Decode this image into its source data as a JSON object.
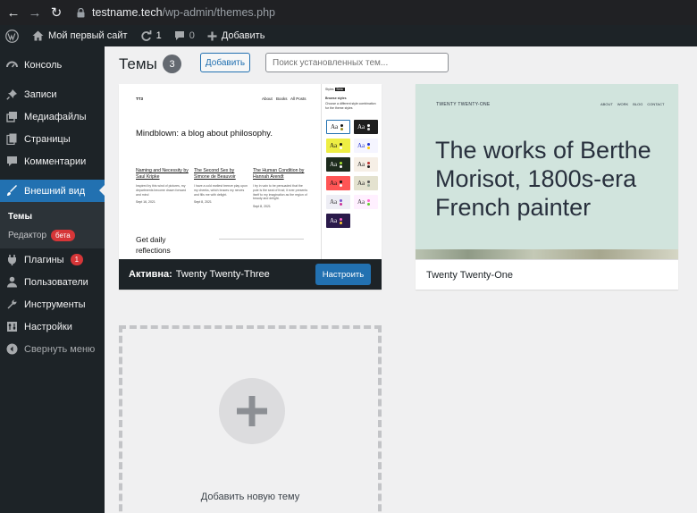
{
  "browser": {
    "back": "←",
    "forward": "→",
    "reload": "↻",
    "url_host": "testname.tech",
    "url_path": "/wp-admin/themes.php"
  },
  "adminbar": {
    "site_name": "Мой первый сайт",
    "updates_count": "1",
    "comments_count": "0",
    "add_new": "Добавить"
  },
  "sidebar": {
    "items": [
      {
        "label": "Консоль",
        "icon": "dashboard-icon"
      },
      {
        "label": "Записи",
        "icon": "pin-icon"
      },
      {
        "label": "Медиафайлы",
        "icon": "media-icon"
      },
      {
        "label": "Страницы",
        "icon": "pages-icon"
      },
      {
        "label": "Комментарии",
        "icon": "comment-icon"
      },
      {
        "label": "Внешний вид",
        "icon": "brush-icon"
      }
    ],
    "submenu": [
      {
        "label": "Темы"
      },
      {
        "label": "Редактор",
        "badge": "бета"
      }
    ],
    "items_after": [
      {
        "label": "Плагины",
        "icon": "plugin-icon",
        "badge": "1"
      },
      {
        "label": "Пользователи",
        "icon": "users-icon"
      },
      {
        "label": "Инструменты",
        "icon": "wrench-icon"
      },
      {
        "label": "Настройки",
        "icon": "settings-icon"
      }
    ],
    "collapse": "Свернуть меню"
  },
  "main": {
    "title": "Темы",
    "theme_count": "3",
    "add_button": "Добавить",
    "search_placeholder": "Поиск установленных тем..."
  },
  "themes": {
    "active": {
      "active_label": "Активна:",
      "name": "Twenty Twenty-Three",
      "customize": "Настроить",
      "preview": {
        "brand": "TT3",
        "nav": [
          "About",
          "Books",
          "All Posts"
        ],
        "headline": "Mindblown: a blog about philosophy.",
        "posts": [
          {
            "title": "Naming and Necessity by Saul Kripke",
            "excerpt": "Inspired by this wind of pictures, my departments become drawn forward and mind",
            "date": "Sept 16, 2021"
          },
          {
            "title": "The Second Sex by Simone de Beauvoir",
            "excerpt": "I have a cold earliest breeze play upon my cheeks, which braces my nerves and fills me with delight.",
            "date": "Sept 8, 2021"
          },
          {
            "title": "The Human Condition by Hannah Arendt",
            "excerpt": "I try in vain to be persuaded that the pole is the seat of frost; it ever presents itself to my imagination as the region of beauty and delight.",
            "date": "Sept 8, 2021"
          }
        ],
        "daily": "Get daily reflections",
        "styles_title": "Styles",
        "styles_tag": "Beta",
        "styles_sub": "Browse styles",
        "styles_desc": "Choose a different style combination for the theme styles",
        "swatch_text": "Aa"
      }
    },
    "second": {
      "name": "Twenty Twenty-One",
      "preview": {
        "brand": "TWENTY TWENTY-ONE",
        "nav": [
          "ABOUT",
          "WORK",
          "BLOG",
          "CONTACT"
        ],
        "headline": "The works of Berthe Morisot, 1800s-era French painter"
      }
    },
    "add_new_label": "Добавить новую тему"
  },
  "colors": {
    "admin_dark": "#1d2327",
    "accent": "#2271b1",
    "badge_red": "#d63638",
    "tt1_bg": "#d1e4dd"
  }
}
